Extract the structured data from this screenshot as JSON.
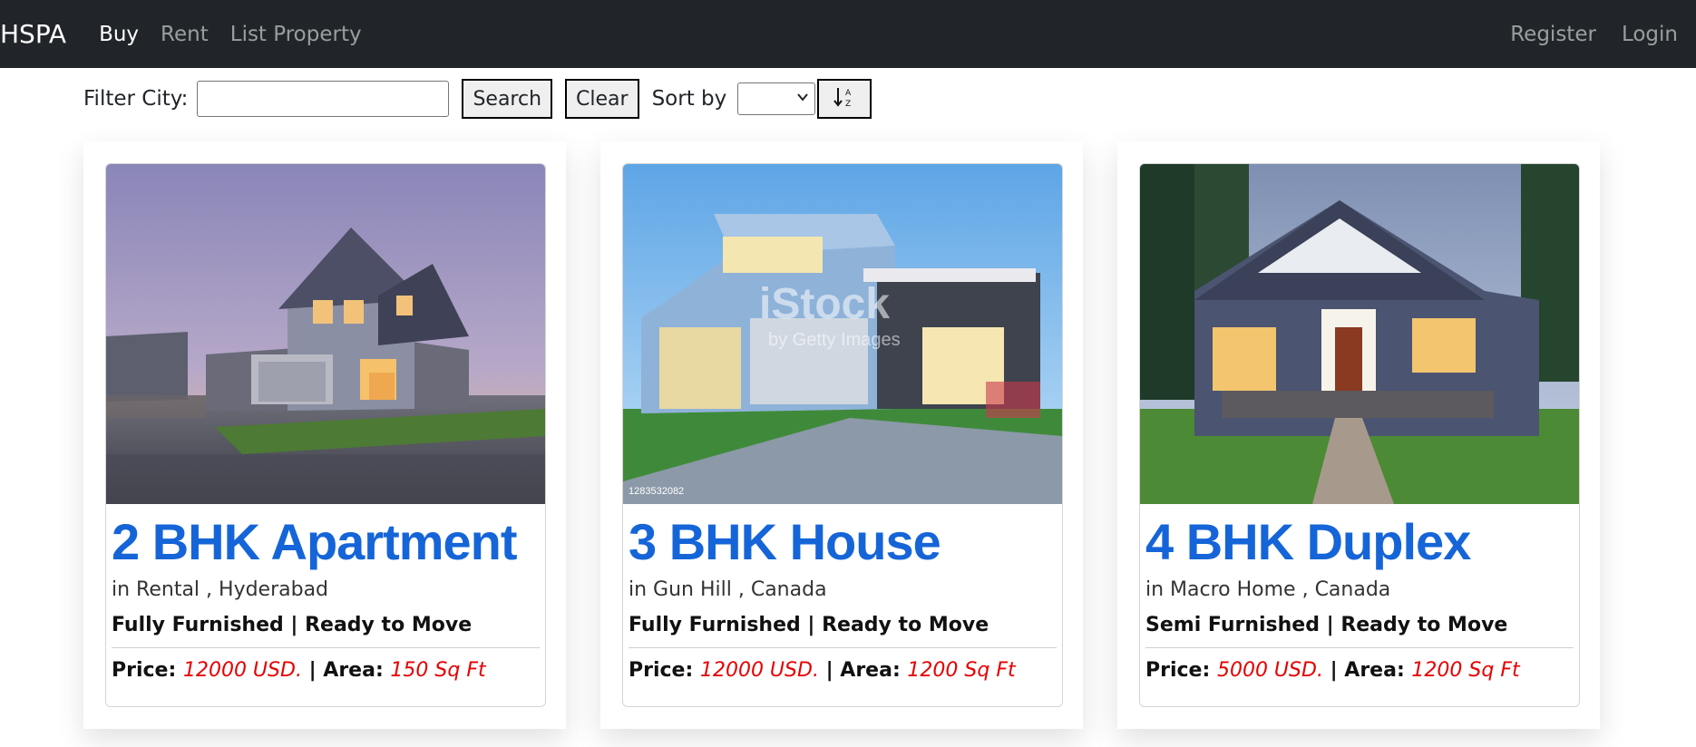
{
  "nav": {
    "brand": "HSPA",
    "links": [
      "Buy",
      "Rent",
      "List Property"
    ],
    "right_links": [
      "Register",
      "Login"
    ]
  },
  "filter": {
    "city_label": "Filter City:",
    "city_value": "",
    "search_label": "Search",
    "clear_label": "Clear",
    "sort_label": "Sort by",
    "sort_value": "",
    "sort_toggle_icon": "sort-alpha-icon"
  },
  "cards": [
    {
      "title": "2 BHK Apartment",
      "location": "in Rental , Hyderabad",
      "features": "Fully Furnished | Ready to Move",
      "price_label": "Price:",
      "price": "12000 USD.",
      "area_label": "| Area:",
      "area": "150 Sq Ft"
    },
    {
      "title": "3 BHK House",
      "location": "in Gun Hill , Canada",
      "features": "Fully Furnished | Ready to Move",
      "price_label": "Price:",
      "price": "12000 USD.",
      "area_label": "| Area:",
      "area": "1200 Sq Ft",
      "watermark": "iStock",
      "watermark_sub": "by Getty Images",
      "image_code": "1283532082"
    },
    {
      "title": "4 BHK Duplex",
      "location": "in Macro Home , Canada",
      "features": "Semi Furnished | Ready to Move",
      "price_label": "Price:",
      "price": "5000 USD.",
      "area_label": "| Area:",
      "area": "1200 Sq Ft"
    }
  ],
  "colors": {
    "navbar": "#212529",
    "title_blue": "#1565d8",
    "price_red": "#e60000"
  }
}
